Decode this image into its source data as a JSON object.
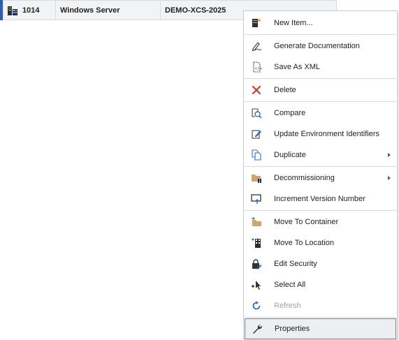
{
  "row": {
    "id": "1014",
    "os": "Windows Server",
    "name": "DEMO-XCS-2025"
  },
  "menu": {
    "new_item": "New Item...",
    "generate_documentation": "Generate Documentation",
    "save_as_xml": "Save As XML",
    "delete": "Delete",
    "compare": "Compare",
    "update_env_ids": "Update Environment Identifiers",
    "duplicate": "Duplicate",
    "decommissioning": "Decommissioning",
    "increment_version": "Increment Version Number",
    "move_to_container": "Move To Container",
    "move_to_location": "Move To Location",
    "edit_security": "Edit Security",
    "select_all": "Select All",
    "refresh": "Refresh",
    "properties": "Properties"
  },
  "icons": {
    "row": "server-icon",
    "new_item": "new-item-icon",
    "generate_documentation": "pen-icon",
    "save_as_xml": "save-xml-icon",
    "delete": "red-x-icon",
    "compare": "compare-icon",
    "update_env_ids": "edit-document-icon",
    "duplicate": "duplicate-icon",
    "decommissioning": "folder-pause-icon",
    "increment_version": "monitor-arrow-icon",
    "move_to_container": "folder-arrow-icon",
    "move_to_location": "building-icon",
    "edit_security": "lock-pen-icon",
    "select_all": "select-all-icon",
    "refresh": "refresh-icon",
    "properties": "wrench-icon"
  },
  "colors": {
    "selection_bar": "#2a5fb8",
    "delete_red": "#d23a2a",
    "refresh_blue": "#2f6fc0",
    "folder_tan": "#c9a86a"
  }
}
